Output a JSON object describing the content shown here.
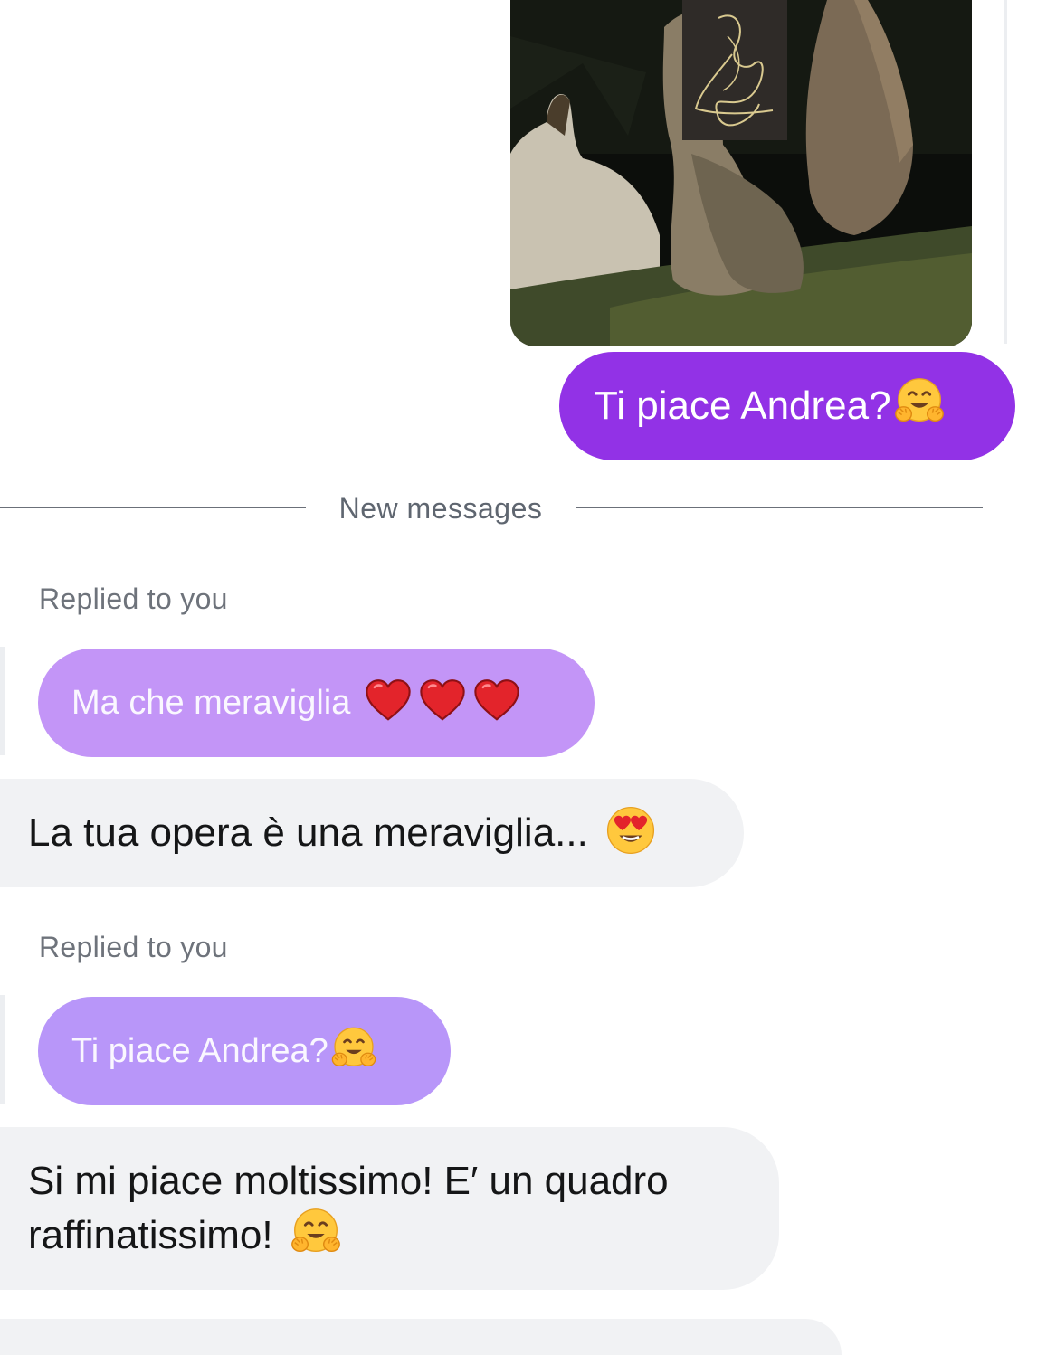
{
  "thread": {
    "sent_image": {
      "alt": "photo of artwork on stones at night"
    },
    "sent_message": {
      "text": "Ti piace Andrea?",
      "emoji_icon": "hugging-face-icon"
    },
    "divider": {
      "label": "New messages"
    },
    "replies": [
      {
        "replied_label": "Replied to you",
        "quoted_text": "Ma che meraviglia",
        "quoted_emoji_icons": [
          "red-heart-icon",
          "red-heart-icon",
          "red-heart-icon"
        ],
        "message_text": "La tua opera è una meraviglia...",
        "message_emoji_icon": "heart-eyes-face-icon"
      },
      {
        "replied_label": "Replied to you",
        "quoted_text": "Ti piace Andrea?",
        "quoted_emoji_icon": "hugging-face-icon",
        "message_text": "Si mi piace moltissimo! E′ un quadro\nraffinatissimo!",
        "message_emoji_icon": "hugging-face-icon"
      }
    ]
  },
  "colors": {
    "sent_bubble": "#9232e6",
    "quoted_bubble_1": "#c395f7",
    "quoted_bubble_2": "#b896f9",
    "received_bubble": "#f1f2f4",
    "divider": "#6b7079"
  }
}
